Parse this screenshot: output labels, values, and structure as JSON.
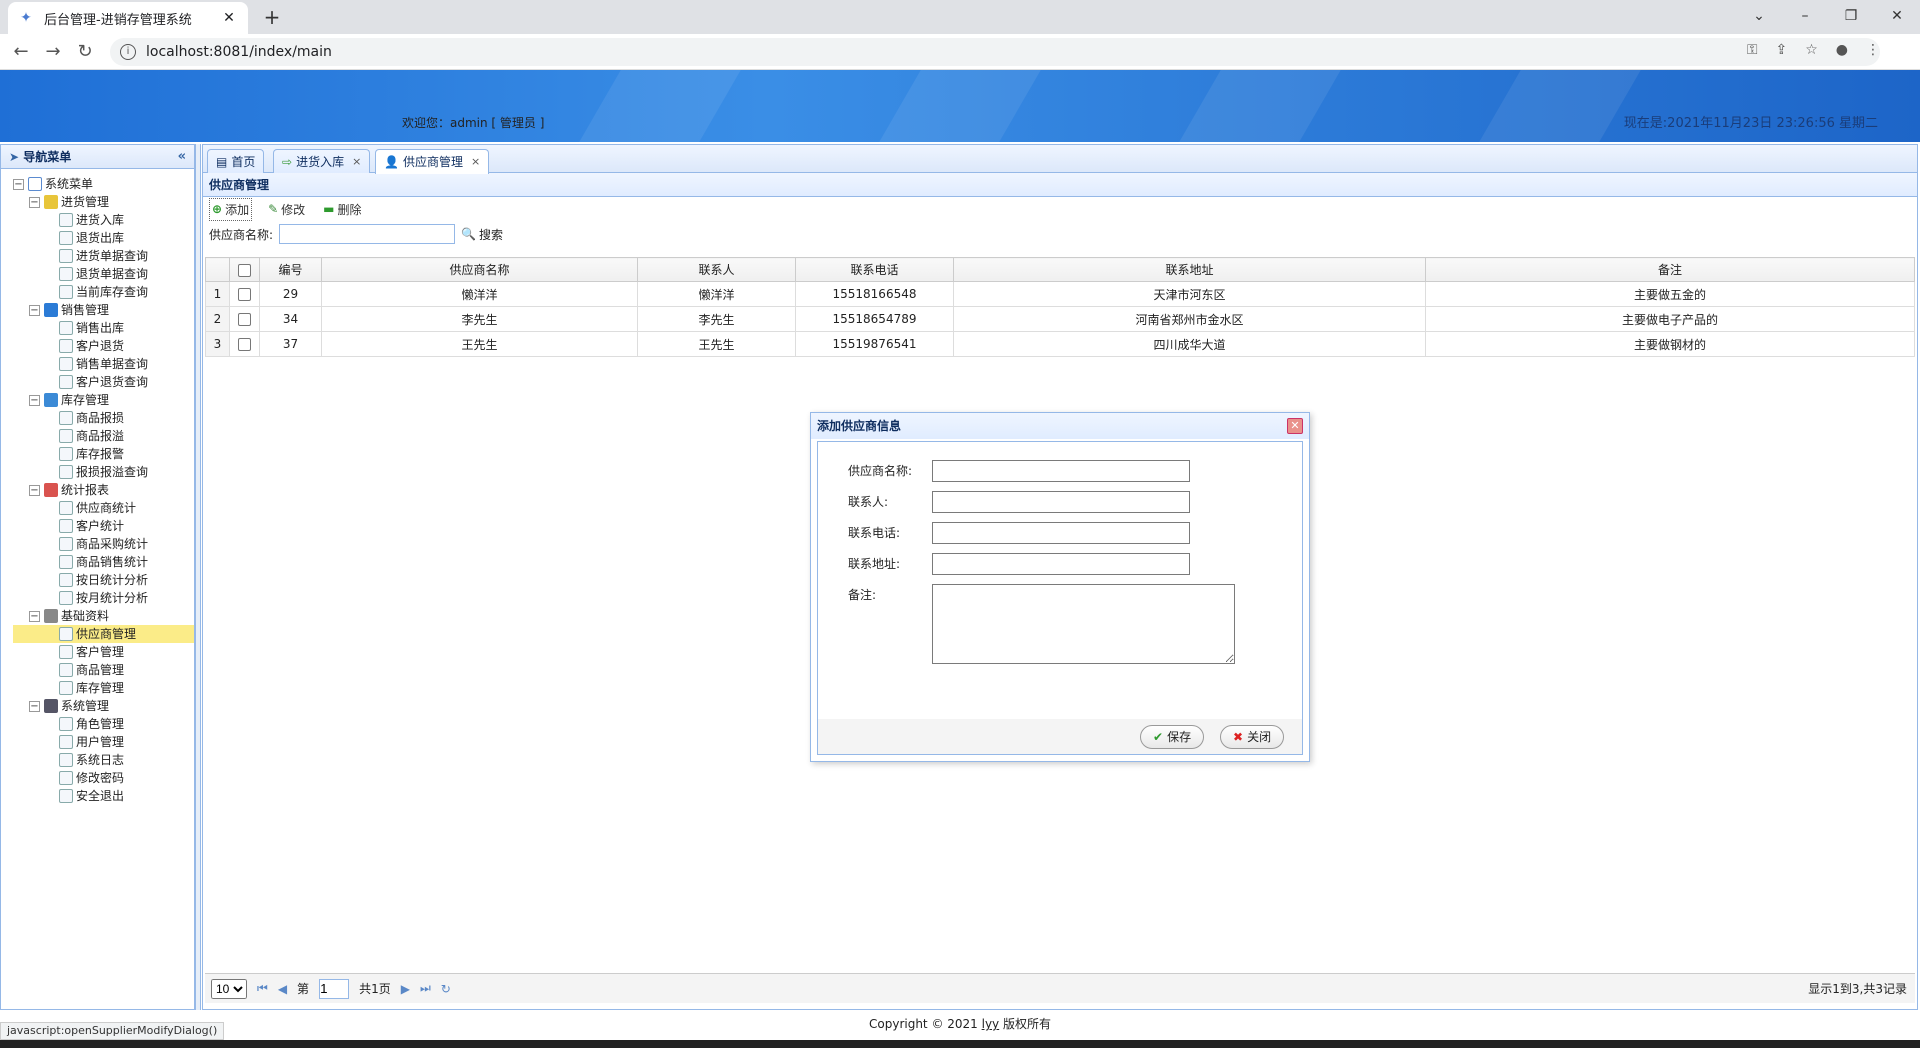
{
  "browser": {
    "tab_title": "后台管理-进销存管理系统",
    "url": "localhost:8081/index/main"
  },
  "header": {
    "welcome": "欢迎您：admin [ 管理员 ]",
    "clock": "现在是:2021年11月23日 23:26:56 星期二"
  },
  "nav": {
    "title": "导航菜单",
    "root": "系统菜单",
    "groups": [
      {
        "label": "进货管理",
        "items": [
          "进货入库",
          "退货出库",
          "进货单据查询",
          "退货单据查询",
          "当前库存查询"
        ]
      },
      {
        "label": "销售管理",
        "items": [
          "销售出库",
          "客户退货",
          "销售单据查询",
          "客户退货查询"
        ]
      },
      {
        "label": "库存管理",
        "items": [
          "商品报损",
          "商品报溢",
          "库存报警",
          "报损报溢查询"
        ]
      },
      {
        "label": "统计报表",
        "items": [
          "供应商统计",
          "客户统计",
          "商品采购统计",
          "商品销售统计",
          "按日统计分析",
          "按月统计分析"
        ]
      },
      {
        "label": "基础资料",
        "items": [
          "供应商管理",
          "客户管理",
          "商品管理",
          "库存管理"
        ]
      },
      {
        "label": "系统管理",
        "items": [
          "角色管理",
          "用户管理",
          "系统日志",
          "修改密码",
          "安全退出"
        ]
      }
    ]
  },
  "tabs": [
    "首页",
    "进货入库",
    "供应商管理"
  ],
  "panel": {
    "title": "供应商管理",
    "add": "添加",
    "edit": "修改",
    "delete": "删除",
    "search_label": "供应商名称:",
    "search_btn": "搜索"
  },
  "grid": {
    "columns": [
      "编号",
      "供应商名称",
      "联系人",
      "联系电话",
      "联系地址",
      "备注"
    ],
    "rows": [
      [
        "1",
        "29",
        "懒洋洋",
        "懒洋洋",
        "15518166548",
        "天津市河东区",
        "主要做五金的"
      ],
      [
        "2",
        "34",
        "李先生",
        "李先生",
        "15518654789",
        "河南省郑州市金水区",
        "主要做电子产品的"
      ],
      [
        "3",
        "37",
        "王先生",
        "王先生",
        "15519876541",
        "四川成华大道",
        "主要做钢材的"
      ]
    ]
  },
  "pager": {
    "page_size": "10",
    "page_prefix": "第",
    "page_value": "1",
    "page_total": "共1页",
    "summary": "显示1到3,共3记录"
  },
  "dialog": {
    "title": "添加供应商信息",
    "fields": [
      "供应商名称:",
      "联系人:",
      "联系电话:",
      "联系地址:",
      "备注:"
    ],
    "save": "保存",
    "close": "关闭"
  },
  "footer": {
    "copyright_prefix": "Copyright © 2021 ",
    "copyright_link": "lyy",
    "copyright_suffix": " 版权所有",
    "status": "javascript:openSupplierModifyDialog()"
  },
  "colors": {
    "header_blue": "#1f6fd6",
    "border_blue": "#95b8e7",
    "selected_yellow": "#fbec88"
  }
}
